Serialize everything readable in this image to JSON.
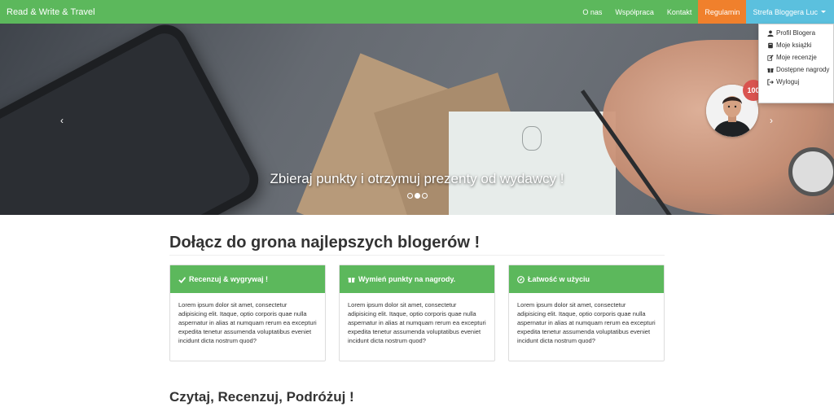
{
  "navbar": {
    "brand": "Read & Write & Travel",
    "items": [
      {
        "label": "O nas"
      },
      {
        "label": "Współpraca"
      },
      {
        "label": "Kontakt"
      },
      {
        "label": "Regulamin"
      },
      {
        "label": "Strefa Bloggera Luc"
      }
    ]
  },
  "dropdown": {
    "items": [
      {
        "label": "Profil Blogera",
        "icon": "user-icon"
      },
      {
        "label": "Moje książki",
        "icon": "book-icon"
      },
      {
        "label": "Moje recenzje",
        "icon": "edit-icon"
      },
      {
        "label": "Dostępne nagrody",
        "icon": "gift-icon"
      },
      {
        "label": "Wyloguj",
        "icon": "logout-icon"
      }
    ]
  },
  "hero": {
    "caption": "Zbieraj punkty i otrzymuj prezenty od wydawcy !",
    "prev": "‹",
    "next": "›",
    "slides": 3,
    "active_slide": 2
  },
  "profile": {
    "points": "100"
  },
  "main": {
    "heading": "Dołącz do grona najlepszych blogerów !",
    "panels": [
      {
        "title": "Recenzuj & wygrywaj !",
        "icon": "check-icon",
        "body": "Lorem ipsum dolor sit amet, consectetur adipisicing elit. Itaque, optio corporis quae nulla aspernatur in alias at numquam rerum ea excepturi expedita tenetur assumenda voluptatibus eveniet incidunt dicta nostrum quod?"
      },
      {
        "title": "Wymień punkty na nagrody.",
        "icon": "gift-icon",
        "body": "Lorem ipsum dolor sit amet, consectetur adipisicing elit. Itaque, optio corporis quae nulla aspernatur in alias at numquam rerum ea excepturi expedita tenetur assumenda voluptatibus eveniet incidunt dicta nostrum quod?"
      },
      {
        "title": "Łatwość w użyciu",
        "icon": "compass-icon",
        "body": "Lorem ipsum dolor sit amet, consectetur adipisicing elit. Itaque, optio corporis quae nulla aspernatur in alias at numquam rerum ea excepturi expedita tenetur assumenda voluptatibus eveniet incidunt dicta nostrum quod?"
      }
    ],
    "heading2": "Czytaj, Recenzuj, Podróżuj !"
  },
  "colors": {
    "navbar": "#5cb85c",
    "regulamin": "#f0802c",
    "strefa": "#5bc0de",
    "badge": "#d9534f"
  }
}
